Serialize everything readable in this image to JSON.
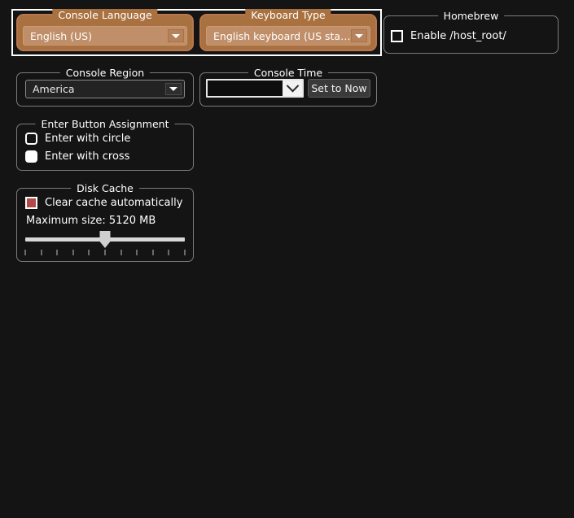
{
  "theme": {
    "background": "#141414",
    "accent_group_bg": "#a9713f",
    "accent_combo_bg": "#c08f69",
    "focus_outline": "#ffffff",
    "group_border": "#7b7b7b",
    "checkbox_checked_fill": "#b04a4a",
    "text": "#ffffff"
  },
  "groups": {
    "console_language": {
      "title": "Console Language",
      "combo": {
        "value": "English (US)",
        "arrow_icon": "chevron-down-icon"
      }
    },
    "keyboard_type": {
      "title": "Keyboard Type",
      "combo": {
        "value": "English keyboard (US standard)",
        "arrow_icon": "chevron-down-icon"
      }
    },
    "homebrew": {
      "title": "Homebrew",
      "checkbox": {
        "label": "Enable /host_root/",
        "checked": false
      }
    },
    "console_region": {
      "title": "Console Region",
      "combo": {
        "value": "America",
        "arrow_icon": "chevron-down-icon"
      }
    },
    "console_time": {
      "title": "Console Time",
      "datetime": {
        "value": "",
        "arrow_icon": "chevron-down-icon"
      },
      "set_now_button": "Set to Now"
    },
    "enter_button_assignment": {
      "title": "Enter Button Assignment",
      "options": [
        {
          "label": "Enter with circle",
          "selected": false
        },
        {
          "label": "Enter with cross",
          "selected": true
        }
      ]
    },
    "disk_cache": {
      "title": "Disk Cache",
      "checkbox": {
        "label": "Clear cache automatically",
        "checked": true
      },
      "max_size_label": "Maximum size: 5120 MB",
      "slider": {
        "position_percent": 50,
        "tick_count": 11
      }
    }
  }
}
